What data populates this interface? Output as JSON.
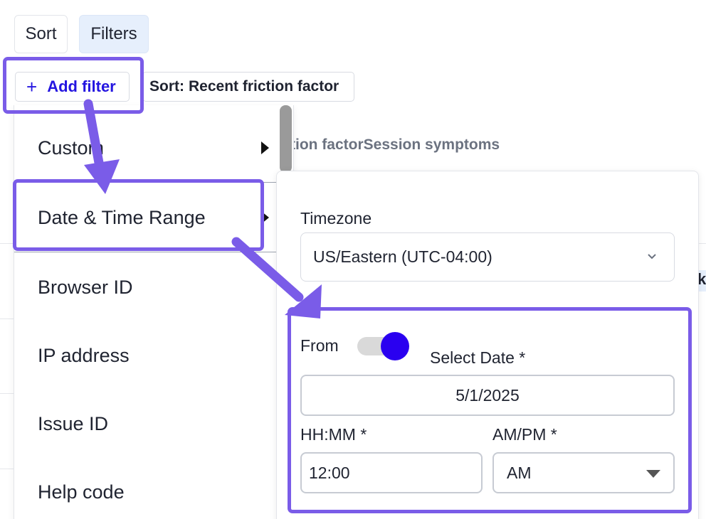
{
  "toolbar": {
    "sort_label": "Sort",
    "filters_label": "Filters"
  },
  "filter_bar": {
    "add_filter_icon": "+",
    "add_filter_label": "Add filter",
    "sort_chip_prefix": "Sort:",
    "sort_chip_value": "Recent friction factor"
  },
  "table": {
    "col_header_a": "tion factor",
    "col_header_b": "Session symptoms",
    "peek_text": "k"
  },
  "menu": {
    "items": [
      {
        "label": "Custom",
        "icon": "caret-right-icon"
      },
      {
        "label": "Date & Time Range",
        "icon": "caret-right-icon"
      },
      {
        "label": "Browser ID"
      },
      {
        "label": "IP address"
      },
      {
        "label": "Issue ID"
      },
      {
        "label": "Help code"
      }
    ]
  },
  "panel": {
    "timezone_label": "Timezone",
    "timezone_value": "US/Eastern (UTC-04:00)",
    "from_label": "From",
    "select_date_label": "Select Date *",
    "date_value": "5/1/2025",
    "time_label": "HH:MM *",
    "time_value": "12:00",
    "ampm_label": "AM/PM *",
    "ampm_value": "AM",
    "toggle_on": true
  },
  "colors": {
    "accent": "#7a5ce8",
    "link": "#2415e0",
    "toggle": "#2a00f0",
    "chip_bg": "#e6effc"
  }
}
